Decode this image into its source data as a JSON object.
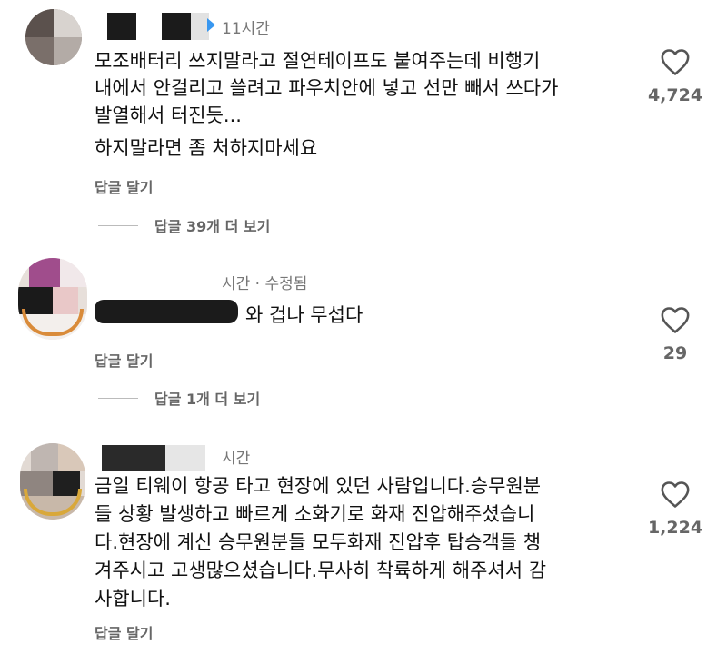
{
  "comments": [
    {
      "time": "11시간",
      "lines": [
        "모조배터리 쓰지말라고 절연테이프도 붙여주는데 비행기",
        "내에서 안걸리고 쓸려고 파우치안에 넣고 선만 빼서 쓰다가",
        "발열해서 터진듯...",
        "하지말라면 좀 처하지마세요"
      ],
      "reply_label": "답글 달기",
      "likes": "4,724",
      "more_replies": "답글 39개 더 보기"
    },
    {
      "time": "시간 · 수정됨",
      "text": "와 겁나 무섭다",
      "reply_label": "답글 달기",
      "likes": "29",
      "more_replies": "답글 1개 더 보기"
    },
    {
      "time": "시간",
      "lines": [
        "금일 티웨이 항공 타고 현장에 있던 사람입니다.승무원분",
        "들 상황 발생하고 빠르게 소화기로 화재 진압해주셨습니",
        "다.현장에 계신 승무원분들 모두화재 진압후 탑승객들 챙",
        "겨주시고 고생많으셨습니다.무사히 착륙하게 해주셔서 감",
        "사합니다."
      ],
      "reply_label": "답글 달기",
      "likes": "1,224"
    }
  ],
  "icons": {
    "like": "heart-outline-icon",
    "verified": "verified-badge-icon"
  },
  "colors": {
    "text": "#111111",
    "secondary": "#777777",
    "verified": "#3897f0"
  }
}
